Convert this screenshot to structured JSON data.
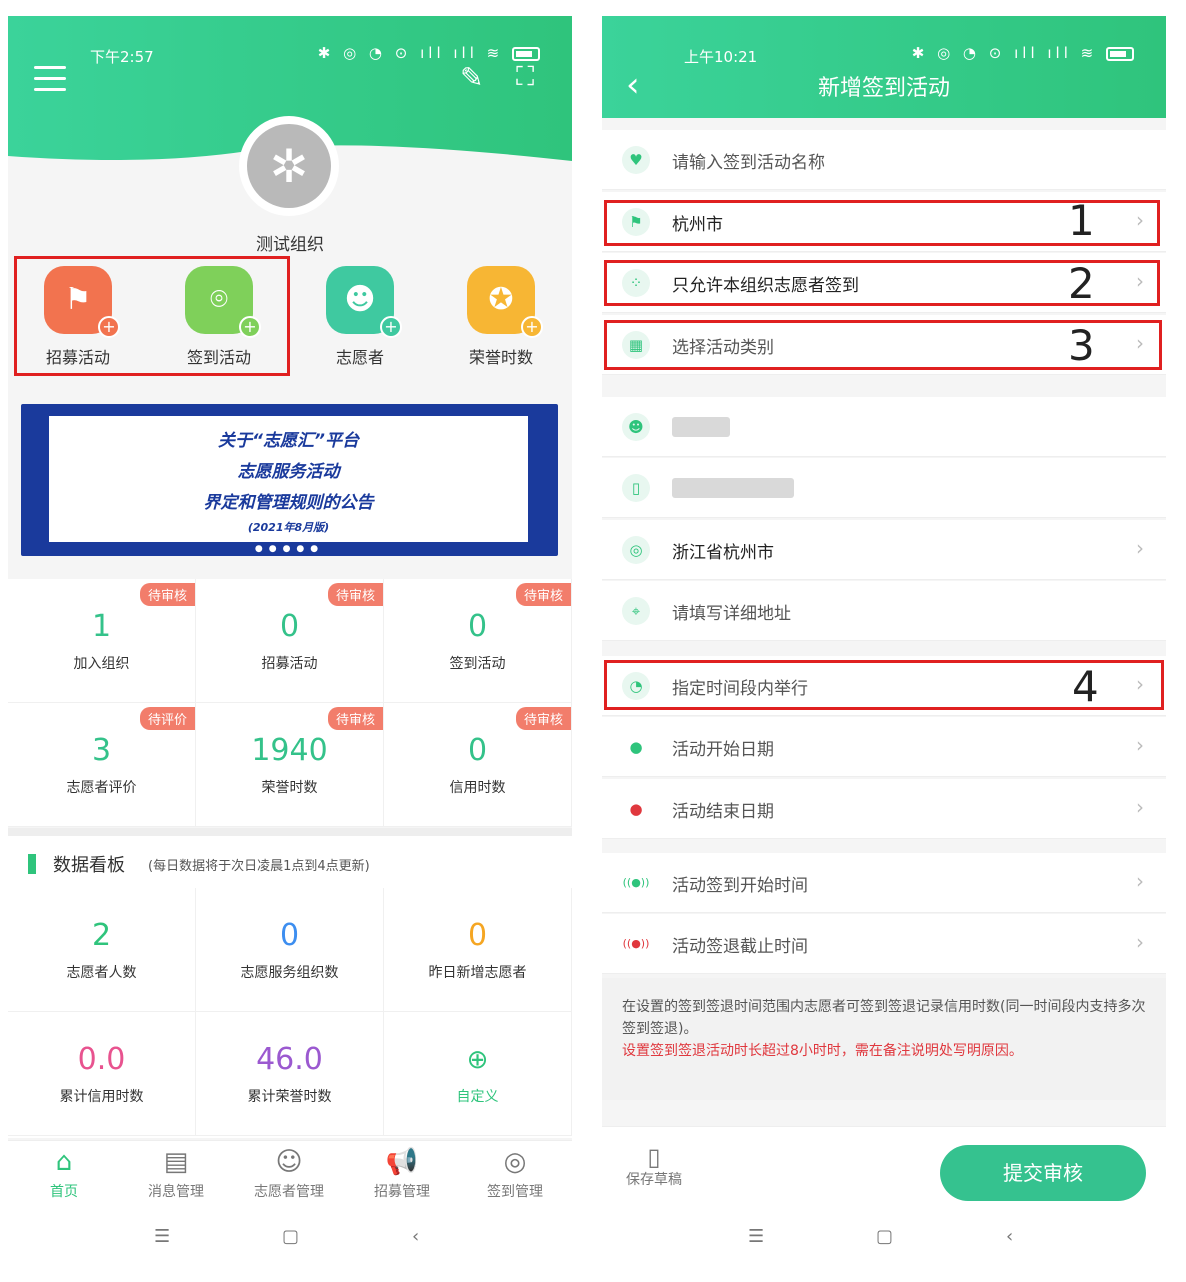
{
  "left": {
    "status_time": "下午2:57",
    "org_name": "测试组织",
    "quick": [
      {
        "label": "招募活动",
        "color": "#f2734f"
      },
      {
        "label": "签到活动",
        "color": "#7fd05a"
      },
      {
        "label": "志愿者",
        "color": "#3fc9a0"
      },
      {
        "label": "荣誉时数",
        "color": "#f7b634"
      }
    ],
    "banner": {
      "line1": "关于“志愿汇”平台",
      "line2": "志愿服务活动",
      "line3": "界定和管理规则的公告",
      "line4": "(2021年8月版)"
    },
    "stats": [
      {
        "badge": "待审核",
        "value": "1",
        "label": "加入组织"
      },
      {
        "badge": "待审核",
        "value": "0",
        "label": "招募活动"
      },
      {
        "badge": "待审核",
        "value": "0",
        "label": "签到活动"
      },
      {
        "badge": "待评价",
        "value": "3",
        "label": "志愿者评价"
      },
      {
        "badge": "待审核",
        "value": "1940",
        "label": "荣誉时数"
      },
      {
        "badge": "待审核",
        "value": "0",
        "label": "信用时数"
      }
    ],
    "dashboard": {
      "title": "数据看板",
      "subtitle": "(每日数据将于次日凌晨1点到4点更新)",
      "items": [
        {
          "value": "2",
          "label": "志愿者人数",
          "color": "#2fc47c"
        },
        {
          "value": "0",
          "label": "志愿服务组织数",
          "color": "#3d8ef0"
        },
        {
          "value": "0",
          "label": "昨日新增志愿者",
          "color": "#f5a623"
        },
        {
          "value": "0.0",
          "label": "累计信用时数",
          "color": "#e8538f"
        },
        {
          "value": "46.0",
          "label": "累计荣誉时数",
          "color": "#9b59d0"
        },
        {
          "value": "",
          "label": "自定义",
          "color": "#2fc47c"
        }
      ]
    },
    "tabs": [
      {
        "label": "首页",
        "icon": "home-icon",
        "active": true
      },
      {
        "label": "消息管理",
        "icon": "message-icon",
        "active": false
      },
      {
        "label": "志愿者管理",
        "icon": "volunteer-icon",
        "active": false
      },
      {
        "label": "招募管理",
        "icon": "megaphone-icon",
        "active": false
      },
      {
        "label": "签到管理",
        "icon": "checkin-icon",
        "active": false
      }
    ]
  },
  "right": {
    "status_time": "上午10:21",
    "title": "新增签到活动",
    "rows": [
      {
        "icon": "heart-icon",
        "text": "请输入签到活动名称",
        "chevron": false,
        "dark": false
      },
      {
        "icon": "flag-icon",
        "text": "杭州市",
        "chevron": true,
        "dark": true,
        "annot": "1"
      },
      {
        "icon": "group-icon",
        "text": "只允许本组织志愿者签到",
        "chevron": true,
        "dark": true,
        "annot": "2"
      },
      {
        "icon": "grid-icon",
        "text": "选择活动类别",
        "chevron": true,
        "dark": false,
        "annot": "3"
      },
      {
        "icon": "user-icon",
        "text": "",
        "chevron": false,
        "dark": false
      },
      {
        "icon": "phone-icon",
        "text": "",
        "chevron": false,
        "dark": false
      },
      {
        "icon": "location-icon",
        "text": "浙江省杭州市",
        "chevron": true,
        "dark": true
      },
      {
        "icon": "target-icon",
        "text": "请填写详细地址",
        "chevron": false,
        "dark": false
      },
      {
        "icon": "clock-icon",
        "text": "指定时间段内举行",
        "chevron": true,
        "dark": false,
        "annot": "4"
      },
      {
        "icon": "start-dot-icon",
        "text": "活动开始日期",
        "chevron": true,
        "dark": false
      },
      {
        "icon": "end-dot-icon",
        "text": "活动结束日期",
        "chevron": true,
        "dark": false
      },
      {
        "icon": "signal-green-icon",
        "text": "活动签到开始时间",
        "chevron": true,
        "dark": false
      },
      {
        "icon": "signal-red-icon",
        "text": "活动签退截止时间",
        "chevron": true,
        "dark": false
      }
    ],
    "note": "在设置的签到签退时间范围内志愿者可签到签退记录信用时数(同一时间段内支持多次签到签退)。",
    "note_red": "设置签到签退活动时长超过8小时时，需在备注说明处写明原因。",
    "save_draft": "保存草稿",
    "submit": "提交审核"
  }
}
